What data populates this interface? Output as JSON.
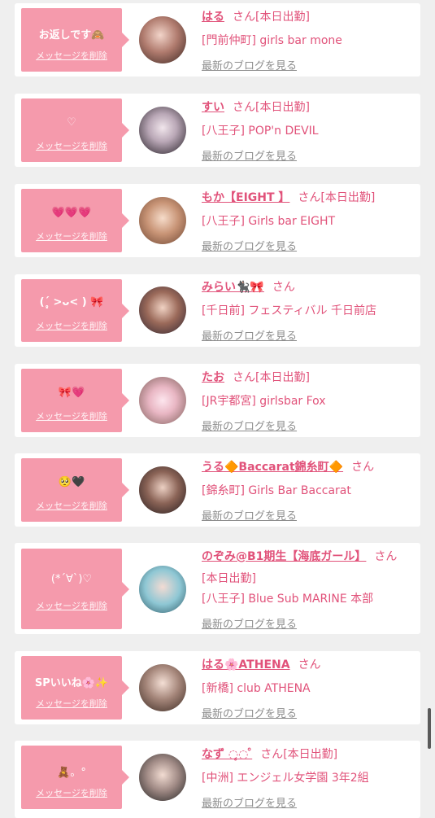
{
  "delete_label": "メッセージを削除",
  "blog_label": "最新のブログを見る",
  "honorific": "さん",
  "cards": [
    {
      "message": "お返しです🙈",
      "name": "はる",
      "status": "[本日出勤]",
      "shop": "[門前仲町] girls bar mone"
    },
    {
      "message": "♡",
      "name": "すい",
      "status": "[本日出勤]",
      "shop": "[八王子] POP'n DEVIL"
    },
    {
      "message": "💗💗💗",
      "name": "もか【EIGHT 】",
      "status": "[本日出勤]",
      "shop": "[八王子] Girls bar EIGHT"
    },
    {
      "message": "(ˊ̥̥̥̥̥ >ᴗ< ) 🎀",
      "name": "みらい🐈‍⬛🎀",
      "status": "",
      "shop": "[千日前] フェスティバル 千日前店"
    },
    {
      "message": "🎀💗",
      "name": "たお",
      "status": "[本日出勤]",
      "shop": "[JR宇都宮] girlsbar Fox"
    },
    {
      "message": "🥺🖤",
      "name": "うる🔶Baccarat錦糸町🔶",
      "status": "",
      "shop": "[錦糸町] Girls Bar Baccarat"
    },
    {
      "message": "(*ˊ∀ˋ)♡",
      "name": "のぞみ@B1期生【海底ガール】",
      "status": "[本日出勤]",
      "shop": "[八王子] Blue Sub MARINE 本部"
    },
    {
      "message": "SPいいね🌸✨",
      "name": "はる🌸ATHENA",
      "status": "",
      "shop": "[新橋] club ATHENA"
    },
    {
      "message": "🧸。°",
      "name": "なず ◌̥◌ ̊",
      "status": "[本日出勤]",
      "shop": "[中洲] エンジェル女学園 3年2組"
    }
  ],
  "colors": {
    "bubble": "#f59aac",
    "accent": "#e1527a",
    "link_gray": "#8d8d8d",
    "background": "#efefef"
  }
}
